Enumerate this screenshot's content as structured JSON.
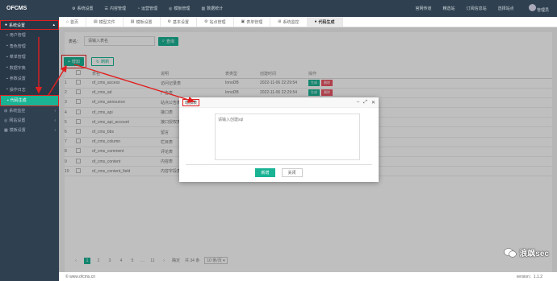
{
  "app": {
    "name": "OFCMS"
  },
  "topnav": [
    {
      "icon": "gear-icon",
      "label": "系统设置"
    },
    {
      "icon": "document-icon",
      "label": "内容管理"
    },
    {
      "icon": "chart-icon",
      "label": "运营管理"
    },
    {
      "icon": "globe-icon",
      "label": "模板管理"
    },
    {
      "icon": "bar-chart-icon",
      "label": "数据统计"
    }
  ],
  "topright": {
    "items": [
      "官网传道",
      "精选站",
      "订阅信息站",
      "选择站点"
    ],
    "user": "管理员"
  },
  "sidebar": {
    "group": "系统设置",
    "items": [
      "用户管理",
      "角色管理",
      "菜单管理",
      "数据字典",
      "参数设置",
      "操作日志",
      "代码生成"
    ],
    "other_groups": [
      "系统监控",
      "网站设置",
      "模板设置"
    ]
  },
  "tabs": [
    "首页",
    "模型文件",
    "模板设置",
    "基本设置",
    "站点管理",
    "表单管理",
    "系统监控",
    "代码生成"
  ],
  "search": {
    "label": "表名：",
    "placeholder": "请输入表名",
    "button": "查询"
  },
  "toolbar": {
    "add": "增加",
    "refresh": "刷新"
  },
  "table": {
    "headers": [
      "",
      "",
      "表名",
      "说明",
      "表类型",
      "创建时间",
      "操作"
    ],
    "ops": {
      "gen": "生成",
      "delete": "删除"
    },
    "rows": [
      {
        "no": "1",
        "name": "of_cms_access",
        "desc": "访问记录表",
        "type": "InnoDB",
        "created": "2022-11-06 22:29:54"
      },
      {
        "no": "2",
        "name": "of_cms_ad",
        "desc": "广告表",
        "type": "InnoDB",
        "created": "2022-11-06 22:29:54"
      },
      {
        "no": "3",
        "name": "of_cms_announce",
        "desc": "站点公告表",
        "type": "",
        "created": ""
      },
      {
        "no": "4",
        "name": "of_cms_api",
        "desc": "接口表",
        "type": "",
        "created": ""
      },
      {
        "no": "5",
        "name": "of_cms_api_account",
        "desc": "接口授权表",
        "type": "",
        "created": ""
      },
      {
        "no": "6",
        "name": "of_cms_bbs",
        "desc": "留言",
        "type": "",
        "created": ""
      },
      {
        "no": "7",
        "name": "of_cms_column",
        "desc": "栏目表",
        "type": "",
        "created": ""
      },
      {
        "no": "8",
        "name": "of_cms_comment",
        "desc": "评论表",
        "type": "",
        "created": ""
      },
      {
        "no": "9",
        "name": "of_cms_content",
        "desc": "内容表",
        "type": "",
        "created": ""
      },
      {
        "no": "10",
        "name": "of_cms_content_field",
        "desc": "内容字段表",
        "type": "InnoDB",
        "created": "2022-11-06 22:29:55"
      }
    ]
  },
  "pagination": {
    "pages": [
      "1",
      "2",
      "3",
      "4",
      "5"
    ],
    "prev": "‹",
    "next": "›",
    "last": "11",
    "goto": "确定",
    "total": "共 34 条",
    "page_size": "10 条/页"
  },
  "modal": {
    "title": "增加表",
    "placeholder": "请输入创建sql",
    "confirm": "新增",
    "close": "关闭"
  },
  "footer": {
    "copyright": "© www.ofcms.cn",
    "version": "version：1.1.2"
  },
  "watermark": "浪飒sec",
  "colors": {
    "accent": "#1ab394",
    "sidebar": "#2f4050",
    "annotation": "#e02020"
  }
}
